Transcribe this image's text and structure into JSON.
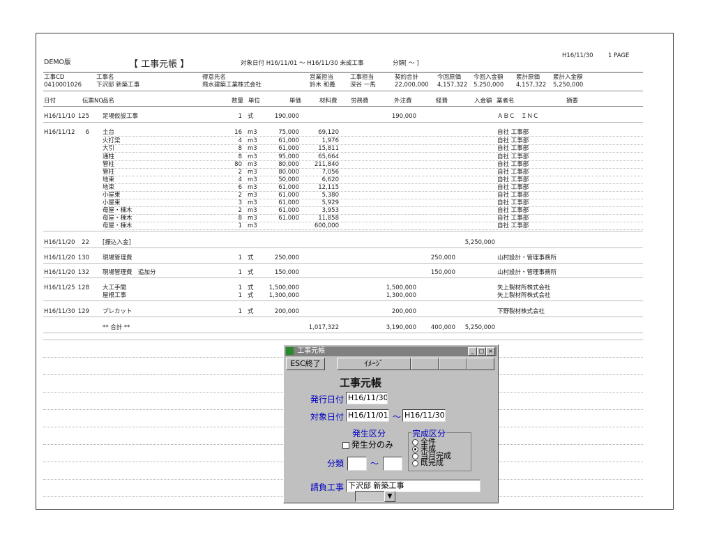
{
  "report": {
    "demo": "DEMO版",
    "title": "【 工事元帳 】",
    "period": "対象日付  H16/11/01 ～ H16/11/30   未成工事",
    "bunrui": "分類[    ～    ]",
    "print_date": "H16/11/30",
    "page": "1 PAGE"
  },
  "project_header": {
    "labels": [
      "工事CD",
      "工事名",
      "得意先名",
      "営業担当",
      "工事担当",
      "契約合計",
      "今回原価",
      "今回入金額",
      "累計原価",
      "累計入金額"
    ],
    "values": [
      "0410001026",
      "下沢邸 新築工事",
      "飛水建築工業株式会社",
      "鈴木 和義",
      "深谷 一馬",
      "22,000,000",
      "4,157,322",
      "5,250,000",
      "4,157,322",
      "5,250,000"
    ]
  },
  "columns": [
    "日付",
    "伝票NO",
    "品名",
    "数量",
    "単位",
    "単価",
    "材料費",
    "労務費",
    "外注費",
    "経費",
    "入金額",
    "業者名",
    "摘要"
  ],
  "rows": [
    {
      "date": "H16/11/10",
      "no": "125",
      "item": "足場仮設工事",
      "qty": "1",
      "unit": "式",
      "price": "190,000",
      "mat": "",
      "lab": "",
      "out": "190,000",
      "exp": "",
      "inc": "",
      "vendor": "ＡＢＣ　ＩＮＣ"
    },
    {
      "date": "H16/11/12",
      "no": "6",
      "item": "土台",
      "qty": "16",
      "unit": "m3",
      "price": "75,000",
      "mat": "69,120",
      "lab": "",
      "out": "",
      "exp": "",
      "inc": "",
      "vendor": "自社 工事部"
    },
    {
      "date": "",
      "no": "",
      "item": "火打梁",
      "qty": "4",
      "unit": "m3",
      "price": "61,000",
      "mat": "1,976",
      "lab": "",
      "out": "",
      "exp": "",
      "inc": "",
      "vendor": "自社 工事部"
    },
    {
      "date": "",
      "no": "",
      "item": "大引",
      "qty": "8",
      "unit": "m3",
      "price": "61,000",
      "mat": "15,811",
      "lab": "",
      "out": "",
      "exp": "",
      "inc": "",
      "vendor": "自社 工事部"
    },
    {
      "date": "",
      "no": "",
      "item": "通柱",
      "qty": "8",
      "unit": "m3",
      "price": "95,000",
      "mat": "65,664",
      "lab": "",
      "out": "",
      "exp": "",
      "inc": "",
      "vendor": "自社 工事部"
    },
    {
      "date": "",
      "no": "",
      "item": "管柱",
      "qty": "80",
      "unit": "m3",
      "price": "80,000",
      "mat": "211,840",
      "lab": "",
      "out": "",
      "exp": "",
      "inc": "",
      "vendor": "自社 工事部"
    },
    {
      "date": "",
      "no": "",
      "item": "管柱",
      "qty": "2",
      "unit": "m3",
      "price": "80,000",
      "mat": "7,056",
      "lab": "",
      "out": "",
      "exp": "",
      "inc": "",
      "vendor": "自社 工事部"
    },
    {
      "date": "",
      "no": "",
      "item": "地束",
      "qty": "4",
      "unit": "m3",
      "price": "50,000",
      "mat": "6,620",
      "lab": "",
      "out": "",
      "exp": "",
      "inc": "",
      "vendor": "自社 工事部"
    },
    {
      "date": "",
      "no": "",
      "item": "地束",
      "qty": "6",
      "unit": "m3",
      "price": "61,000",
      "mat": "12,115",
      "lab": "",
      "out": "",
      "exp": "",
      "inc": "",
      "vendor": "自社 工事部"
    },
    {
      "date": "",
      "no": "",
      "item": "小屋束",
      "qty": "2",
      "unit": "m3",
      "price": "61,000",
      "mat": "5,380",
      "lab": "",
      "out": "",
      "exp": "",
      "inc": "",
      "vendor": "自社 工事部"
    },
    {
      "date": "",
      "no": "",
      "item": "小屋束",
      "qty": "3",
      "unit": "m3",
      "price": "61,000",
      "mat": "5,929",
      "lab": "",
      "out": "",
      "exp": "",
      "inc": "",
      "vendor": "自社 工事部"
    },
    {
      "date": "",
      "no": "",
      "item": "母屋・棟木",
      "qty": "2",
      "unit": "m3",
      "price": "61,000",
      "mat": "3,953",
      "lab": "",
      "out": "",
      "exp": "",
      "inc": "",
      "vendor": "自社 工事部"
    },
    {
      "date": "",
      "no": "",
      "item": "母屋・棟木",
      "qty": "8",
      "unit": "m3",
      "price": "61,000",
      "mat": "11,858",
      "lab": "",
      "out": "",
      "exp": "",
      "inc": "",
      "vendor": "自社 工事部"
    },
    {
      "date": "",
      "no": "",
      "item": "母屋・棟木",
      "qty": "1",
      "unit": "m3",
      "price": "",
      "mat": "600,000",
      "lab": "",
      "out": "",
      "exp": "",
      "inc": "",
      "vendor": "自社 工事部"
    },
    {
      "date": "H16/11/20",
      "no": "22",
      "item": "[振込入金]",
      "qty": "",
      "unit": "",
      "price": "",
      "mat": "",
      "lab": "",
      "out": "",
      "exp": "",
      "inc": "5,250,000",
      "vendor": ""
    },
    {
      "date": "H16/11/20",
      "no": "130",
      "item": "現場管理費",
      "qty": "1",
      "unit": "式",
      "price": "250,000",
      "mat": "",
      "lab": "",
      "out": "",
      "exp": "250,000",
      "inc": "",
      "vendor": "山村設計・管理事務所"
    },
    {
      "date": "H16/11/20",
      "no": "132",
      "item": "現場管理費　追加分",
      "qty": "1",
      "unit": "式",
      "price": "150,000",
      "mat": "",
      "lab": "",
      "out": "",
      "exp": "150,000",
      "inc": "",
      "vendor": "山村設計・管理事務所"
    },
    {
      "date": "H16/11/25",
      "no": "128",
      "item": "大工手間",
      "qty": "1",
      "unit": "式",
      "price": "1,500,000",
      "mat": "",
      "lab": "",
      "out": "1,500,000",
      "exp": "",
      "inc": "",
      "vendor": "矢上製材所株式会社"
    },
    {
      "date": "",
      "no": "",
      "item": "屋根工事",
      "qty": "1",
      "unit": "式",
      "price": "1,300,000",
      "mat": "",
      "lab": "",
      "out": "1,300,000",
      "exp": "",
      "inc": "",
      "vendor": "矢上製材所株式会社"
    },
    {
      "date": "H16/11/30",
      "no": "129",
      "item": "プレカット",
      "qty": "1",
      "unit": "式",
      "price": "200,000",
      "mat": "",
      "lab": "",
      "out": "200,000",
      "exp": "",
      "inc": "",
      "vendor": "下野製材株式会社"
    }
  ],
  "total": {
    "label": "** 合計 **",
    "mat": "1,017,322",
    "out": "3,190,000",
    "exp": "400,000",
    "inc": "5,250,000"
  },
  "dialog": {
    "title": "工事元帳",
    "esc_label": "ESC終了",
    "image_label": "ｲﾒｰｼﾞ",
    "heading": "工事元帳",
    "issue_label": "発行日付",
    "issue_value": "H16/11/30",
    "target_label": "対象日付",
    "target_from": "H16/11/01",
    "tilde": "～",
    "target_to": "H16/11/30",
    "occur_label": "発生区分",
    "occur_only": "発生分のみ",
    "complete_label": "完成区分",
    "complete_options": [
      "全件",
      "未成",
      "当月完成",
      "既完成"
    ],
    "complete_selected": "未成",
    "bunrui_label": "分類",
    "bunrui_from": "",
    "bunrui_to": "",
    "contract_label": "請負工事",
    "contract_value": "下沢邸 新築工事"
  }
}
